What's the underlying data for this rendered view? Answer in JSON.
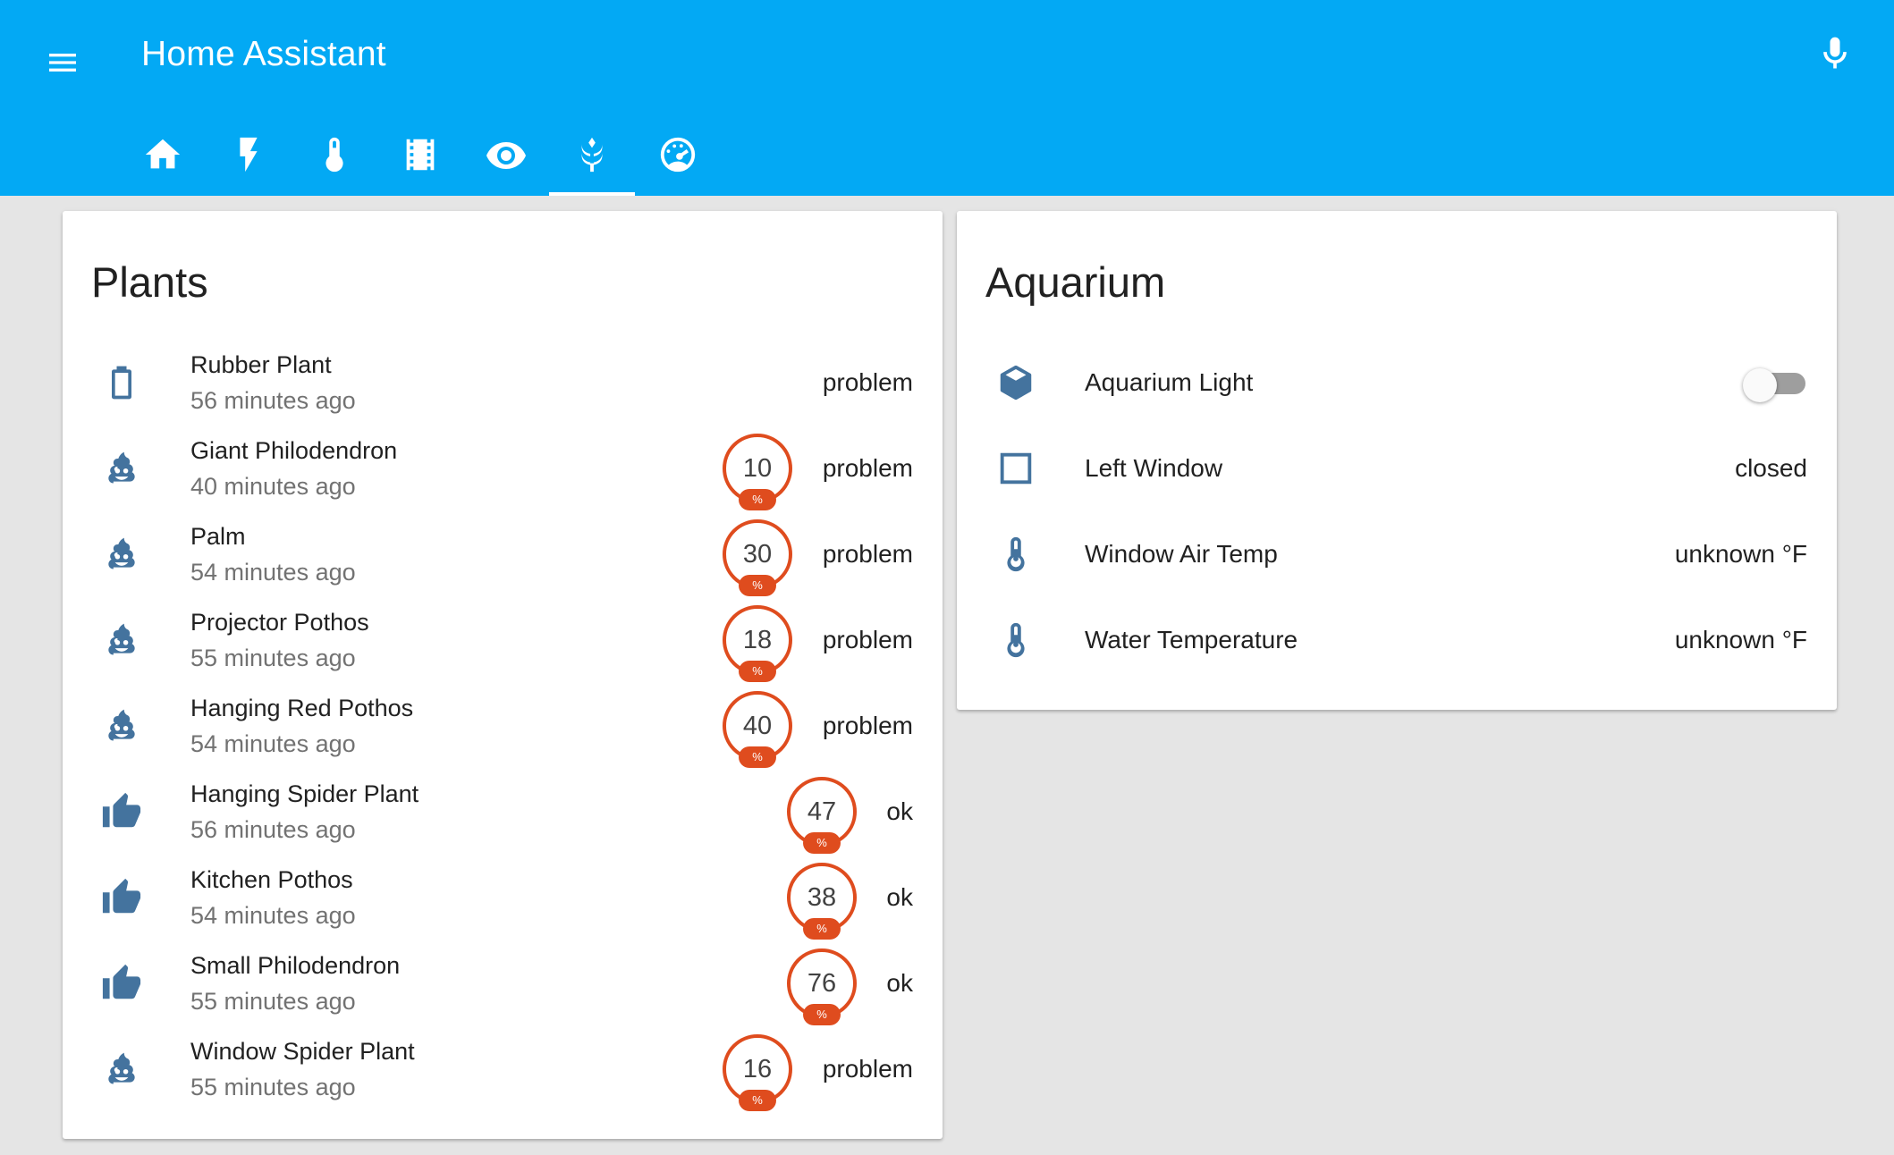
{
  "app": {
    "title": "Home Assistant"
  },
  "colors": {
    "toolbar": "#03a9f4",
    "icon": "#44739e",
    "badge": "#df4c1e"
  },
  "tabs": [
    {
      "icon": "home-icon",
      "selected": false
    },
    {
      "icon": "flash-icon",
      "selected": false
    },
    {
      "icon": "thermometer-icon",
      "selected": false
    },
    {
      "icon": "film-icon",
      "selected": false
    },
    {
      "icon": "eye-icon",
      "selected": false
    },
    {
      "icon": "wheat-icon",
      "selected": true
    },
    {
      "icon": "gauge-icon",
      "selected": false
    }
  ],
  "plants": {
    "title": "Plants",
    "rows": [
      {
        "icon": "battery-icon",
        "name": "Rubber Plant",
        "sub": "56 minutes ago",
        "state": "problem"
      },
      {
        "icon": "emoticon-poop-icon",
        "name": "Giant Philodendron",
        "sub": "40 minutes ago",
        "badge": "10",
        "unit": "%",
        "state": "problem"
      },
      {
        "icon": "emoticon-poop-icon",
        "name": "Palm",
        "sub": "54 minutes ago",
        "badge": "30",
        "unit": "%",
        "state": "problem"
      },
      {
        "icon": "emoticon-poop-icon",
        "name": "Projector Pothos",
        "sub": "55 minutes ago",
        "badge": "18",
        "unit": "%",
        "state": "problem"
      },
      {
        "icon": "emoticon-poop-icon",
        "name": "Hanging Red Pothos",
        "sub": "54 minutes ago",
        "badge": "40",
        "unit": "%",
        "state": "problem"
      },
      {
        "icon": "thumb-up-icon",
        "name": "Hanging Spider Plant",
        "sub": "56 minutes ago",
        "badge": "47",
        "unit": "%",
        "state": "ok"
      },
      {
        "icon": "thumb-up-icon",
        "name": "Kitchen Pothos",
        "sub": "54 minutes ago",
        "badge": "38",
        "unit": "%",
        "state": "ok"
      },
      {
        "icon": "thumb-up-icon",
        "name": "Small Philodendron",
        "sub": "55 minutes ago",
        "badge": "76",
        "unit": "%",
        "state": "ok"
      },
      {
        "icon": "emoticon-poop-icon",
        "name": "Window Spider Plant",
        "sub": "55 minutes ago",
        "badge": "16",
        "unit": "%",
        "state": "problem"
      }
    ]
  },
  "aquarium": {
    "title": "Aquarium",
    "rows": [
      {
        "icon": "cube-icon",
        "name": "Aquarium Light",
        "toggle": false
      },
      {
        "icon": "square-outline-icon",
        "name": "Left Window",
        "state": "closed"
      },
      {
        "icon": "thermometer-icon",
        "name": "Window Air Temp",
        "state": "unknown °F"
      },
      {
        "icon": "thermometer-icon",
        "name": "Water Temperature",
        "state": "unknown °F"
      }
    ]
  }
}
